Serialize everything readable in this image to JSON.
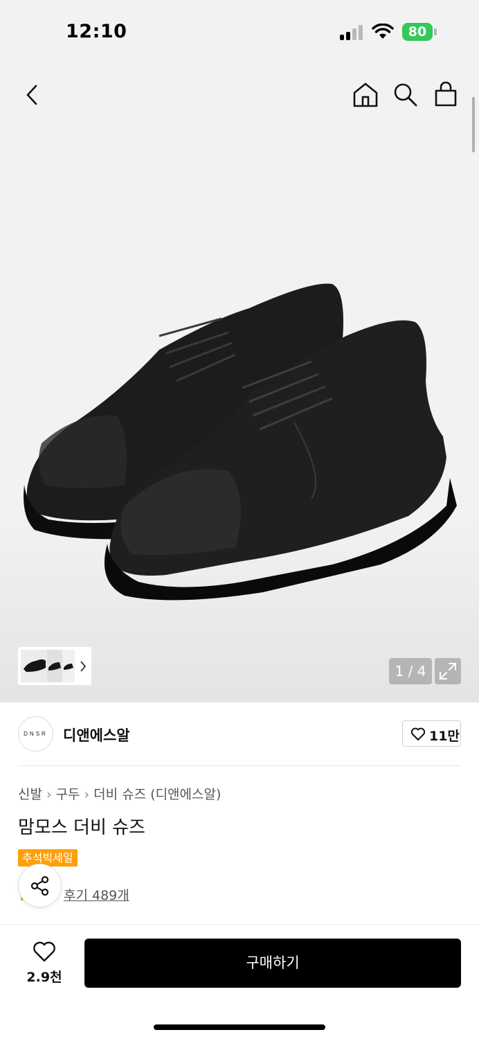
{
  "status_bar": {
    "time": "12:10",
    "battery": "80"
  },
  "nav": {
    "back_icon": "chevron-left-icon",
    "home_icon": "home-icon",
    "search_icon": "search-icon",
    "bag_icon": "shopping-bag-icon"
  },
  "gallery": {
    "page_counter": "1 / 4",
    "expand_icon": "expand-icon"
  },
  "brand": {
    "logo_text": "DNSR",
    "name": "디앤에스알",
    "like_count": "11만"
  },
  "product": {
    "breadcrumb": [
      "신발",
      "구두",
      "더비 슈즈 (디앤에스알)"
    ],
    "title": "맘모스 더비 슈즈",
    "badge": "추석빅세일",
    "review_link": "후기 489개"
  },
  "bottom_bar": {
    "wish_count": "2.9천",
    "buy_label": "구매하기"
  },
  "colors": {
    "accent": "#ff9f0a",
    "battery": "#34c759",
    "buy_button": "#000000"
  }
}
